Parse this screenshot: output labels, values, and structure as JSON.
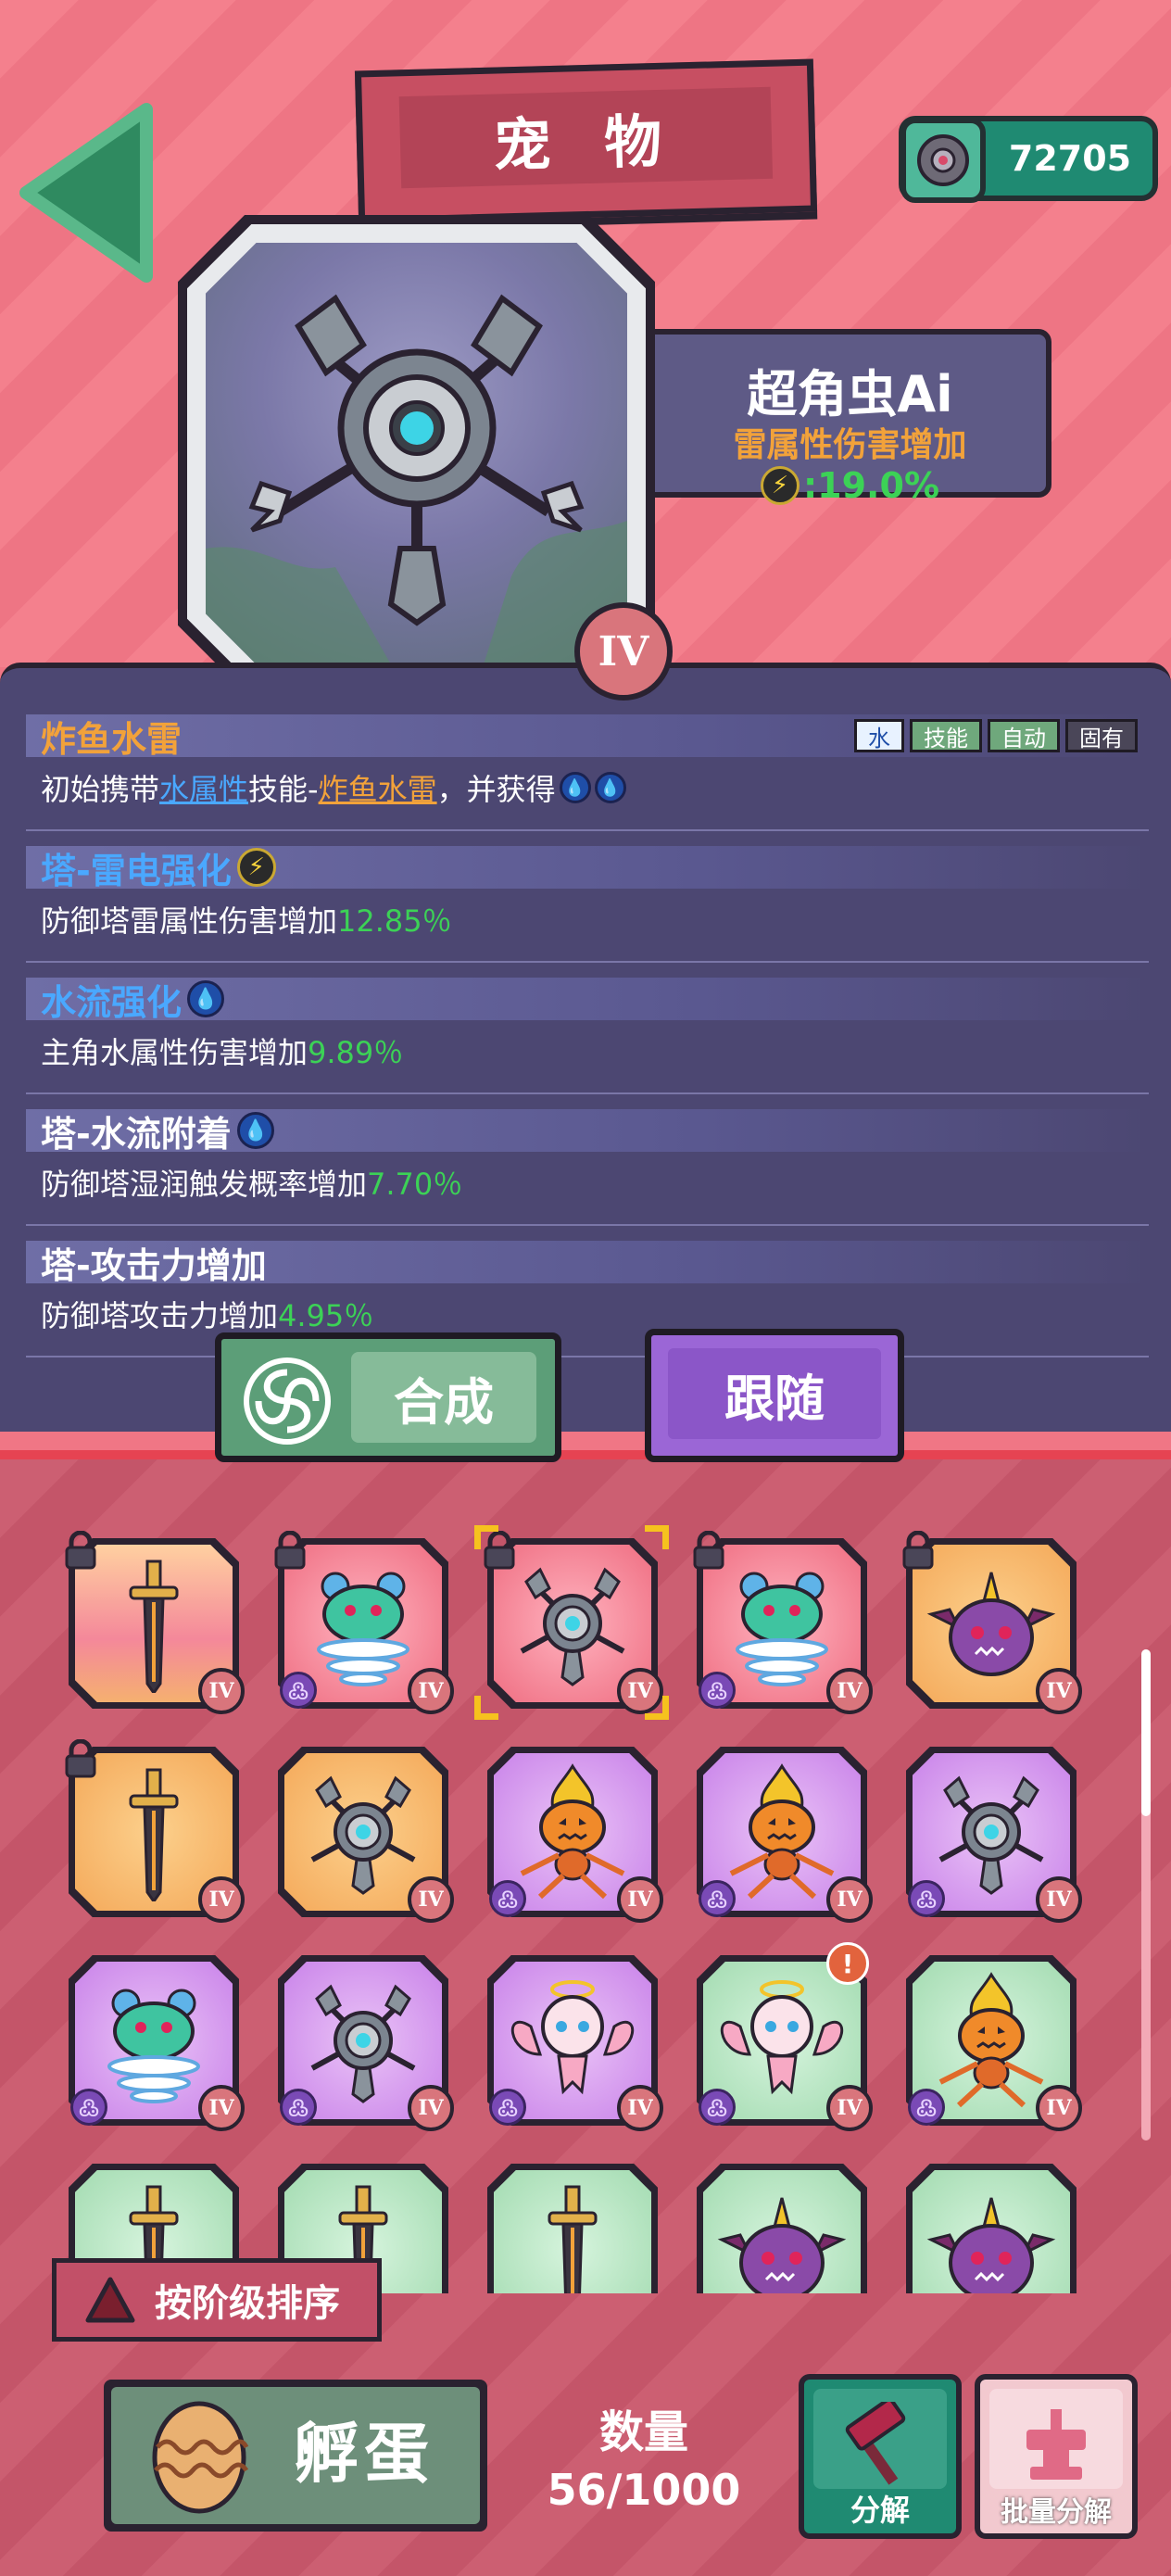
{
  "header": {
    "title": "宠 物",
    "currency_amount": "72705"
  },
  "pet": {
    "name": "超角虫Ai",
    "effect": "雷属性伤害增加",
    "effect_value": ":19.0%",
    "grade": "IV"
  },
  "skills": [
    {
      "title": "炸鱼水雷",
      "tags": [
        "水",
        "技能",
        "自动",
        "固有"
      ],
      "desc_prefix": "初始携带",
      "desc_link1": "水属性",
      "desc_mid": "技能-",
      "desc_link2": "炸鱼水雷",
      "desc_suffix": "，并获得"
    },
    {
      "title": "塔-雷电强化",
      "desc": "防御塔雷属性伤害增加",
      "value": "12.85％"
    },
    {
      "title": "水流强化",
      "desc": "主角水属性伤害增加",
      "value": "9.89％"
    },
    {
      "title": "塔-水流附着",
      "desc": "防御塔湿润触发概率增加",
      "value": "7.70％"
    },
    {
      "title": "塔-攻击力增加",
      "desc": "防御塔攻击力增加",
      "value": "4.95％"
    }
  ],
  "buttons": {
    "combine": "合成",
    "follow": "跟随",
    "sort": "按阶级排序",
    "hatch": "孵蛋",
    "decompose": "分解",
    "bulk_decompose": "批量分解"
  },
  "inventory": {
    "count_label": "数量",
    "count_value": "56/1000",
    "grade_label": "IV",
    "items": [
      {
        "pet": "sword",
        "rarity": "gold-red",
        "locked": true
      },
      {
        "pet": "jellyfish",
        "rarity": "red",
        "locked": true,
        "swirl": true
      },
      {
        "pet": "claw-bot",
        "rarity": "red",
        "locked": true,
        "selected": true
      },
      {
        "pet": "jellyfish",
        "rarity": "red",
        "locked": true,
        "swirl": true
      },
      {
        "pet": "horn-blob",
        "rarity": "gold",
        "locked": true
      },
      {
        "pet": "sword",
        "rarity": "gold",
        "locked": true
      },
      {
        "pet": "claw-bot",
        "rarity": "gold"
      },
      {
        "pet": "fire-pumpkin",
        "rarity": "purple",
        "swirl": true
      },
      {
        "pet": "fire-pumpkin",
        "rarity": "purple",
        "swirl": true
      },
      {
        "pet": "claw-bot",
        "rarity": "purple",
        "swirl": true
      },
      {
        "pet": "jellyfish",
        "rarity": "purple",
        "swirl": true
      },
      {
        "pet": "claw-bot",
        "rarity": "purple",
        "swirl": true
      },
      {
        "pet": "fairy",
        "rarity": "purple",
        "swirl": true
      },
      {
        "pet": "fairy",
        "rarity": "green",
        "swirl": true,
        "alert": true
      },
      {
        "pet": "fire-pumpkin",
        "rarity": "green",
        "swirl": true
      },
      {
        "pet": "sword",
        "rarity": "green"
      },
      {
        "pet": "sword",
        "rarity": "green"
      },
      {
        "pet": "sword",
        "rarity": "green"
      },
      {
        "pet": "horn-blob",
        "rarity": "green"
      },
      {
        "pet": "horn-blob",
        "rarity": "green"
      }
    ]
  },
  "colors": {
    "background": "#f07685",
    "panel": "#4c4772",
    "positive": "#3cd256",
    "accent_orange": "#f2a23a",
    "accent_blue": "#4aa8ff"
  },
  "alert_mark": "!"
}
